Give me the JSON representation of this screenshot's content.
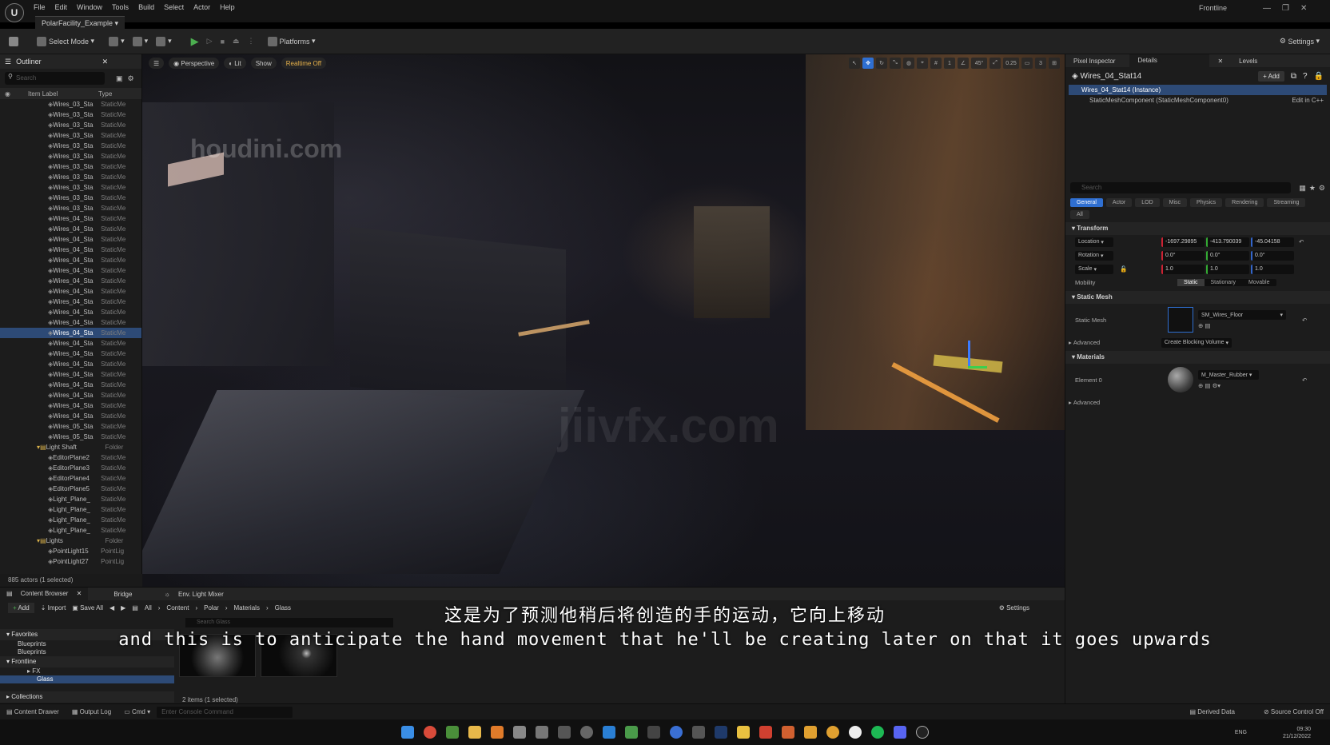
{
  "window": {
    "menu": [
      "File",
      "Edit",
      "Window",
      "Tools",
      "Build",
      "Select",
      "Actor",
      "Help"
    ],
    "project_tab": "PolarFacility_Example",
    "project_name": "Frontline"
  },
  "toolbar": {
    "select_mode": "Select Mode",
    "platforms": "Platforms",
    "settings": "Settings"
  },
  "outliner": {
    "tab": "Outliner",
    "search_placeholder": "Search",
    "col_label": "Item Label",
    "col_type": "Type",
    "rows": [
      {
        "n": "Wires_03_Sta",
        "t": "StaticMe"
      },
      {
        "n": "Wires_03_Sta",
        "t": "StaticMe"
      },
      {
        "n": "Wires_03_Sta",
        "t": "StaticMe"
      },
      {
        "n": "Wires_03_Sta",
        "t": "StaticMe"
      },
      {
        "n": "Wires_03_Sta",
        "t": "StaticMe"
      },
      {
        "n": "Wires_03_Sta",
        "t": "StaticMe"
      },
      {
        "n": "Wires_03_Sta",
        "t": "StaticMe"
      },
      {
        "n": "Wires_03_Sta",
        "t": "StaticMe"
      },
      {
        "n": "Wires_03_Sta",
        "t": "StaticMe"
      },
      {
        "n": "Wires_03_Sta",
        "t": "StaticMe"
      },
      {
        "n": "Wires_03_Sta",
        "t": "StaticMe"
      },
      {
        "n": "Wires_04_Sta",
        "t": "StaticMe"
      },
      {
        "n": "Wires_04_Sta",
        "t": "StaticMe"
      },
      {
        "n": "Wires_04_Sta",
        "t": "StaticMe"
      },
      {
        "n": "Wires_04_Sta",
        "t": "StaticMe"
      },
      {
        "n": "Wires_04_Sta",
        "t": "StaticMe"
      },
      {
        "n": "Wires_04_Sta",
        "t": "StaticMe"
      },
      {
        "n": "Wires_04_Sta",
        "t": "StaticMe"
      },
      {
        "n": "Wires_04_Sta",
        "t": "StaticMe"
      },
      {
        "n": "Wires_04_Sta",
        "t": "StaticMe"
      },
      {
        "n": "Wires_04_Sta",
        "t": "StaticMe"
      },
      {
        "n": "Wires_04_Sta",
        "t": "StaticMe"
      },
      {
        "n": "Wires_04_Sta",
        "t": "StaticMe",
        "sel": true
      },
      {
        "n": "Wires_04_Sta",
        "t": "StaticMe"
      },
      {
        "n": "Wires_04_Sta",
        "t": "StaticMe"
      },
      {
        "n": "Wires_04_Sta",
        "t": "StaticMe"
      },
      {
        "n": "Wires_04_Sta",
        "t": "StaticMe"
      },
      {
        "n": "Wires_04_Sta",
        "t": "StaticMe"
      },
      {
        "n": "Wires_04_Sta",
        "t": "StaticMe"
      },
      {
        "n": "Wires_04_Sta",
        "t": "StaticMe"
      },
      {
        "n": "Wires_04_Sta",
        "t": "StaticMe"
      },
      {
        "n": "Wires_05_Sta",
        "t": "StaticMe"
      },
      {
        "n": "Wires_05_Sta",
        "t": "StaticMe"
      },
      {
        "n": "Light Shaft",
        "t": "Folder",
        "folder": true
      },
      {
        "n": "EditorPlane2",
        "t": "StaticMe"
      },
      {
        "n": "EditorPlane3",
        "t": "StaticMe"
      },
      {
        "n": "EditorPlane4",
        "t": "StaticMe"
      },
      {
        "n": "EditorPlane5",
        "t": "StaticMe"
      },
      {
        "n": "Light_Plane_",
        "t": "StaticMe"
      },
      {
        "n": "Light_Plane_",
        "t": "StaticMe"
      },
      {
        "n": "Light_Plane_",
        "t": "StaticMe"
      },
      {
        "n": "Light_Plane_",
        "t": "StaticMe"
      },
      {
        "n": "Lights",
        "t": "Folder",
        "folder": true
      },
      {
        "n": "PointLight15",
        "t": "PointLig"
      },
      {
        "n": "PointLight27",
        "t": "PointLig"
      }
    ],
    "status": "885 actors (1 selected)"
  },
  "viewport": {
    "perspective": "Perspective",
    "lit": "Lit",
    "show": "Show",
    "realtime": "Realtime Off",
    "snap_angle": "45°",
    "snap_scale": "0.25",
    "cam_speed": "3"
  },
  "details": {
    "tabs": [
      "Pixel Inspector",
      "Details",
      "Levels"
    ],
    "actor": "Wires_04_Stat14",
    "add": "Add",
    "instance": "Wires_04_Stat14 (Instance)",
    "component": "StaticMeshComponent (StaticMeshComponent0)",
    "edit_cpp": "Edit in C++",
    "search_placeholder": "Search",
    "filters": [
      "General",
      "Actor",
      "LOD",
      "Misc",
      "Physics",
      "Rendering",
      "Streaming",
      "All"
    ],
    "transform": "Transform",
    "location": "Location",
    "rotation": "Rotation",
    "scale": "Scale",
    "loc": [
      "-1697.29895",
      "-413.790039",
      "-45.04158"
    ],
    "rot": [
      "0.0°",
      "0.0°",
      "0.0°"
    ],
    "scl": [
      "1.0",
      "1.0",
      "1.0"
    ],
    "mobility": "Mobility",
    "mob_opts": [
      "Static",
      "Stationary",
      "Movable"
    ],
    "static_mesh_sect": "Static Mesh",
    "static_mesh": "Static Mesh",
    "mesh_value": "SM_Wires_Floor",
    "advanced": "Advanced",
    "blocking": "Create Blocking Volume",
    "materials": "Materials",
    "element0": "Element 0",
    "mat_value": "M_Master_Rubber",
    "advanced2": "Advanced"
  },
  "content": {
    "tabs": [
      "Content Browser",
      "Bridge",
      "Env. Light Mixer"
    ],
    "add": "Add",
    "import": "Import",
    "save_all": "Save All",
    "path": [
      "All",
      "Content",
      "Polar",
      "Materials",
      "Glass"
    ],
    "settings": "Settings",
    "favorites": "Favorites",
    "fav_items": [
      "Blueprints",
      "Blueprints"
    ],
    "project": "Frontline",
    "tree": [
      "FX",
      "Glass"
    ],
    "collections": "Collections",
    "search_placeholder": "Search Glass",
    "count": "2 items (1 selected)"
  },
  "subtitle": {
    "cn": "这是为了预测他稍后将创造的手的运动，它向上移动",
    "en": "and this is to anticipate the hand movement that he'll be creating later on that it goes upwards"
  },
  "status": {
    "drawer": "Content Drawer",
    "output": "Output Log",
    "cmd": "Cmd",
    "console": "Enter Console Command",
    "derived": "Derived Data",
    "source": "Source Control Off"
  },
  "taskbar": {
    "lang": "ENG",
    "time": "09:30",
    "date": "21/12/2022"
  },
  "watermarks": [
    "houdini.com",
    "jiivfx.com"
  ]
}
